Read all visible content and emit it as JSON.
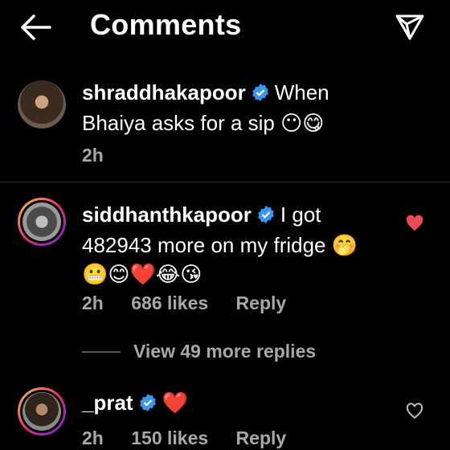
{
  "header": {
    "title": "Comments",
    "back_icon": "arrow-left-icon",
    "send_icon": "paper-plane-icon"
  },
  "comments": [
    {
      "username": "shraddhakapoor",
      "verified": true,
      "text_line1": "When",
      "text_line2": "Bhaiya asks for a sip",
      "emojis": "😶😋",
      "time": "2h",
      "likes": "",
      "reply": "",
      "liked": false
    },
    {
      "username": "siddhanthkapoor",
      "verified": true,
      "text_line1": "I got",
      "text_line2": "482943 more on my fridge",
      "emojis_inline": "🤭",
      "emojis": "😬😊❤️😂😘",
      "time": "2h",
      "likes": "686 likes",
      "reply": "Reply",
      "liked": true
    },
    {
      "username": "_prat",
      "verified": true,
      "emojis": "❤️",
      "time": "2h",
      "likes": "150 likes",
      "reply": "Reply",
      "liked": false
    }
  ],
  "view_more": "View 49 more replies",
  "colors": {
    "background": "#000000",
    "verified": "#3897f0",
    "like_red": "#ed4956",
    "meta_gray": "#a8a8a8"
  }
}
